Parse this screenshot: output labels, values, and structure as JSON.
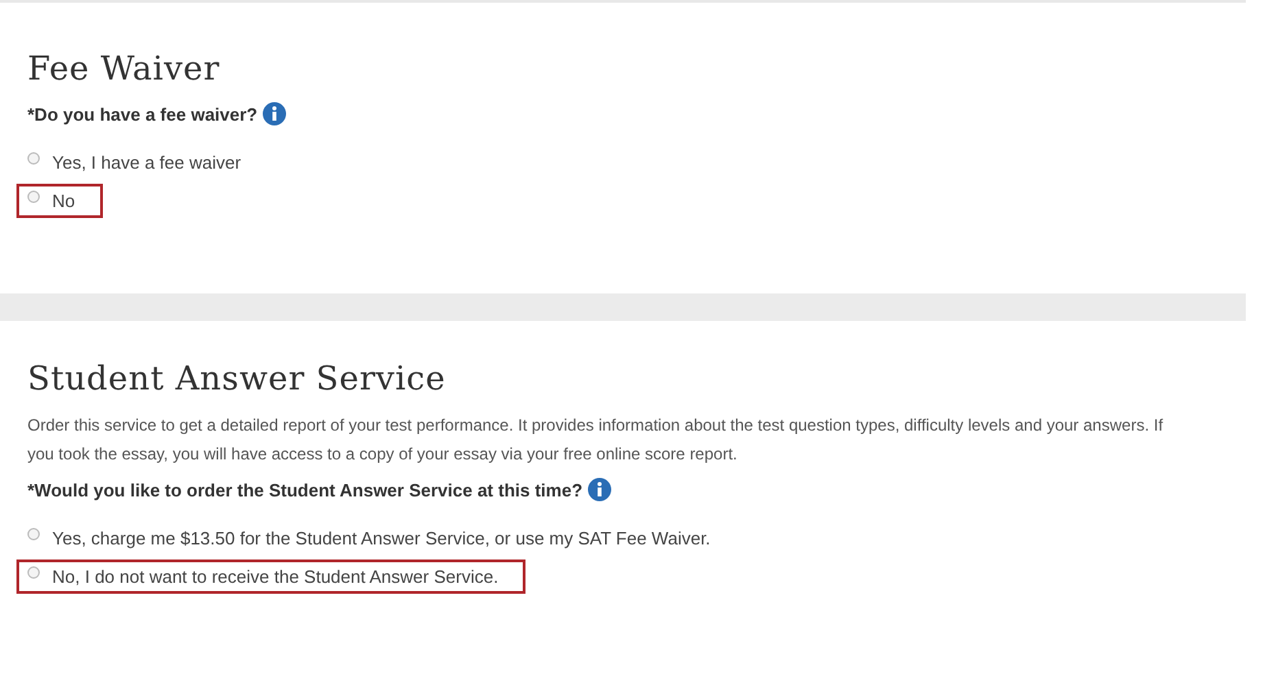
{
  "sections": [
    {
      "title": "Fee Waiver",
      "question": "*Do you have a fee waiver?",
      "options": [
        {
          "label": "Yes, I have a fee waiver",
          "selected": false,
          "highlighted": false
        },
        {
          "label": "No",
          "selected": false,
          "highlighted": true
        }
      ]
    },
    {
      "title": "Student Answer Service",
      "description": "Order this service to get a detailed report of your test performance. It provides information about the test question types, difficulty levels and your answers. If you took the essay, you will have access to a copy of your essay via your free online score report.",
      "question": "*Would you like to order the Student Answer Service at this time?",
      "options": [
        {
          "label": "Yes, charge me $13.50 for the Student Answer Service, or use my SAT Fee Waiver.",
          "selected": false,
          "highlighted": false
        },
        {
          "label": "No, I do not want to receive the Student Answer Service.",
          "selected": false,
          "highlighted": true
        }
      ]
    }
  ]
}
